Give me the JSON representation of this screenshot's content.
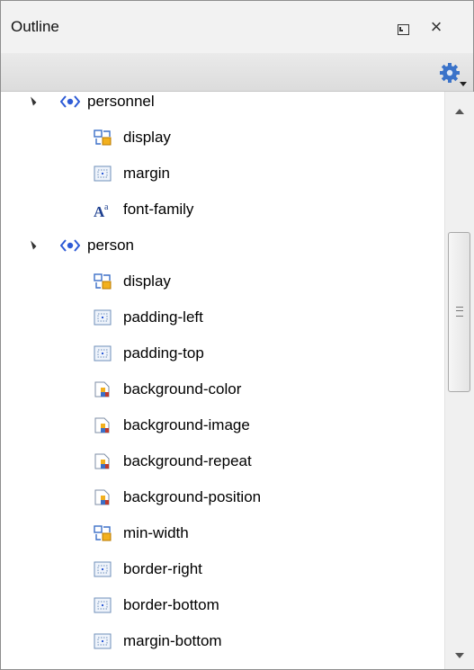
{
  "panel": {
    "title": "Outline",
    "buttons": {
      "maximize": "maximize-icon",
      "close": "close-icon",
      "close_glyph": "×"
    },
    "toolbar": {
      "settings": "gear-icon"
    }
  },
  "tree": {
    "groups": [
      {
        "label": "personnel",
        "expanded": true,
        "children": [
          {
            "label": "display",
            "icon": "layout-property-icon"
          },
          {
            "label": "margin",
            "icon": "box-property-icon"
          },
          {
            "label": "font-family",
            "icon": "font-property-icon"
          }
        ]
      },
      {
        "label": "person",
        "expanded": true,
        "children": [
          {
            "label": "display",
            "icon": "layout-property-icon"
          },
          {
            "label": "padding-left",
            "icon": "box-property-icon"
          },
          {
            "label": "padding-top",
            "icon": "box-property-icon"
          },
          {
            "label": "background-color",
            "icon": "background-property-icon"
          },
          {
            "label": "background-image",
            "icon": "background-property-icon"
          },
          {
            "label": "background-repeat",
            "icon": "background-property-icon"
          },
          {
            "label": "background-position",
            "icon": "background-property-icon"
          },
          {
            "label": "min-width",
            "icon": "layout-property-icon"
          },
          {
            "label": "border-right",
            "icon": "box-property-icon"
          },
          {
            "label": "border-bottom",
            "icon": "box-property-icon"
          },
          {
            "label": "margin-bottom",
            "icon": "box-property-icon"
          }
        ]
      }
    ]
  },
  "colors": {
    "tag_icon": "#2d5bd6",
    "accent_gold": "#f2b01e",
    "accent_blue": "#3b6fc7",
    "accent_red": "#c0392b"
  }
}
